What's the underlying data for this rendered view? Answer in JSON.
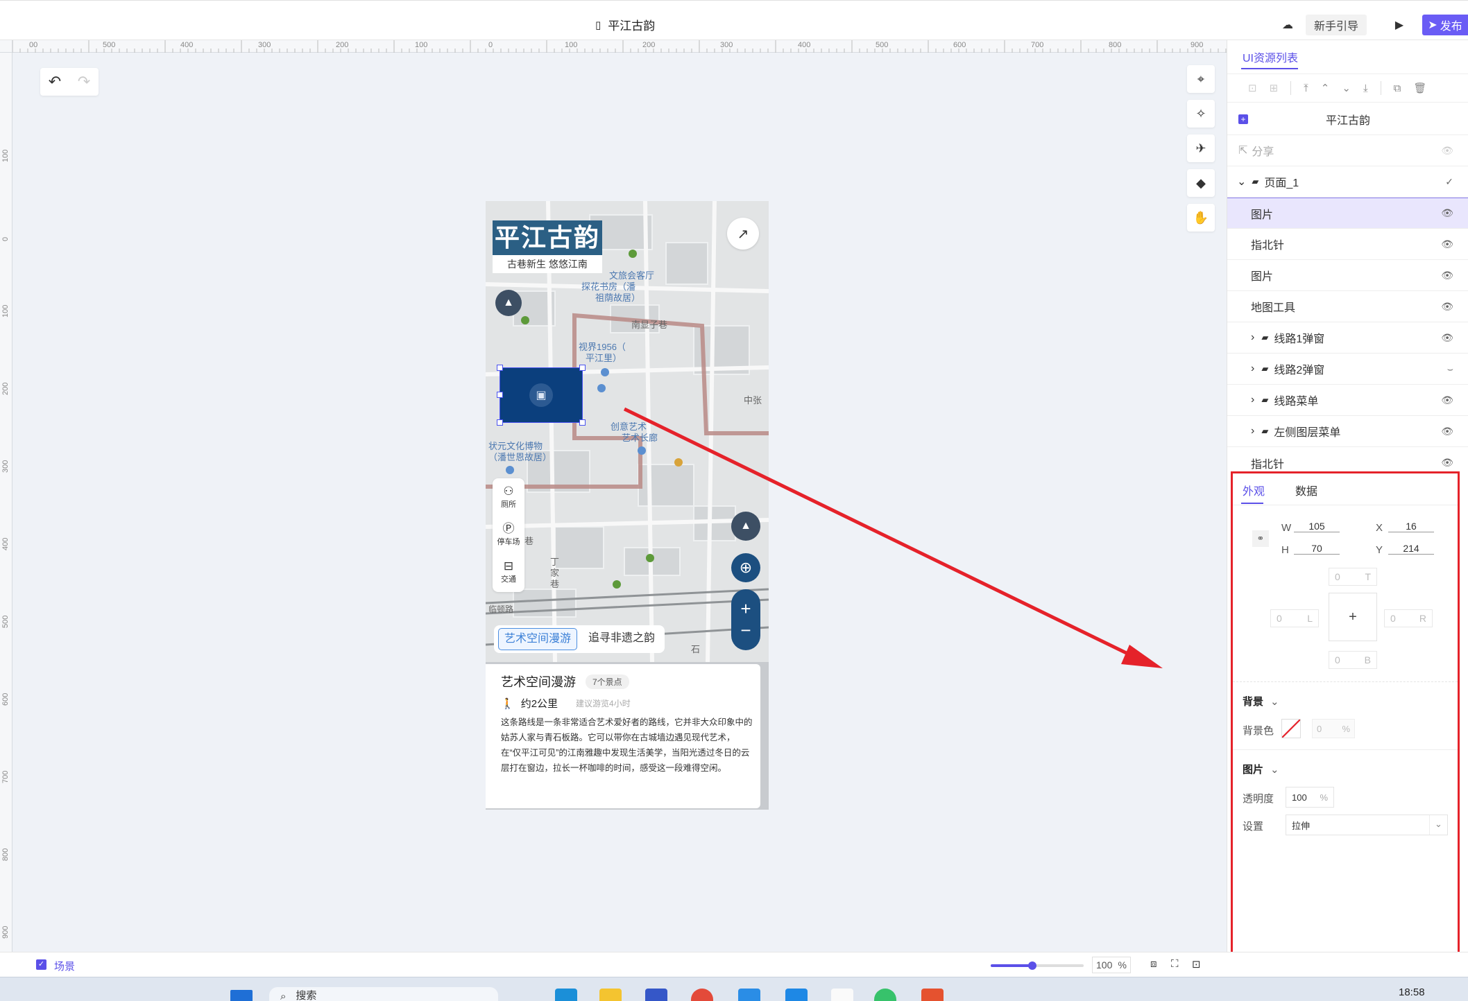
{
  "topbar": {
    "title": "平江古韵",
    "guide": "新手引导",
    "publish": "发布"
  },
  "ruler": {
    "top": [
      "00",
      "500",
      "400",
      "300",
      "200",
      "100",
      "0",
      "100",
      "200",
      "300",
      "400",
      "500",
      "600",
      "700",
      "800",
      "900"
    ],
    "left": [
      "100",
      "0",
      "100",
      "200",
      "300",
      "400",
      "500",
      "600",
      "700",
      "800",
      "900"
    ]
  },
  "phone": {
    "logo_title": "平江古韵",
    "logo_sub": "古巷新生 悠悠江南",
    "side_tools": [
      {
        "label": "厕所",
        "icon": "toilet-icon"
      },
      {
        "label": "停车场",
        "icon": "parking-icon"
      },
      {
        "label": "交通",
        "icon": "bus-icon"
      }
    ],
    "route_tabs": [
      "艺术空间漫游",
      "追寻非遗之韵"
    ],
    "map_labels": [
      "文旅会客厅",
      "探花书房（潘",
      "祖荫故居）",
      "视界1956（",
      "平江里）",
      "南显子巷",
      "状元文化博物",
      "（潘世恩故居）",
      "创意艺术",
      "艺术长廊",
      "中张",
      "巷",
      "丁",
      "家",
      "巷",
      "临顿路",
      "石"
    ],
    "card": {
      "title": "艺术空间漫游",
      "badge": "7个景点",
      "distance": "约2公里",
      "hint": "建议游览4小时",
      "desc": "这条路线是一条非常适合艺术爱好者的路线，它并非大众印象中的姑苏人家与青石板路。它可以带你在古城墙边遇见现代艺术，在“仅平江可见”的江南雅趣中发现生活美学，当阳光透过冬日的云层打在窗边，拉长一杯咖啡的时间，感受这一段难得空闲。"
    }
  },
  "right_panel": {
    "tab": "UI资源列表",
    "project": "平江古韵",
    "share": "分享",
    "layers": [
      {
        "label": "页面_1",
        "state": "check"
      },
      {
        "label": "图片",
        "state": "eye",
        "selected": true
      },
      {
        "label": "指北针",
        "state": "eye"
      },
      {
        "label": "图片",
        "state": "eye"
      },
      {
        "label": "地图工具",
        "state": "eye"
      },
      {
        "label": "线路1弹窗",
        "state": "eye",
        "folder": true
      },
      {
        "label": "线路2弹窗",
        "state": "hidden",
        "folder": true
      },
      {
        "label": "线路菜单",
        "state": "eye",
        "folder": true
      },
      {
        "label": "左侧图层菜单",
        "state": "eye",
        "folder": true
      },
      {
        "label": "指北针",
        "state": "eye"
      }
    ]
  },
  "props": {
    "tabs": [
      "外观",
      "数据"
    ],
    "w_label": "W",
    "w": "105",
    "h_label": "H",
    "h": "70",
    "x_label": "X",
    "x": "16",
    "y_label": "Y",
    "y": "214",
    "margin": {
      "t": "0",
      "t_label": "T",
      "l": "0",
      "l_label": "L",
      "r": "0",
      "r_label": "R",
      "b": "0",
      "b_label": "B"
    },
    "bg_section": "背景",
    "bg_color_label": "背景色",
    "bg_opacity": "0",
    "bg_unit": "%",
    "img_section": "图片",
    "opacity_label": "透明度",
    "opacity": "100",
    "opacity_unit": "%",
    "setting_label": "设置",
    "setting_value": "拉伸"
  },
  "status": {
    "scene": "场景",
    "zoom": "100",
    "zoom_unit": "%"
  },
  "taskbar": {
    "search": "搜索",
    "time": "18:58"
  },
  "colors": {
    "accent": "#5b50e8",
    "highlight": "#e5222a",
    "map_blue": "#1c4f80"
  }
}
